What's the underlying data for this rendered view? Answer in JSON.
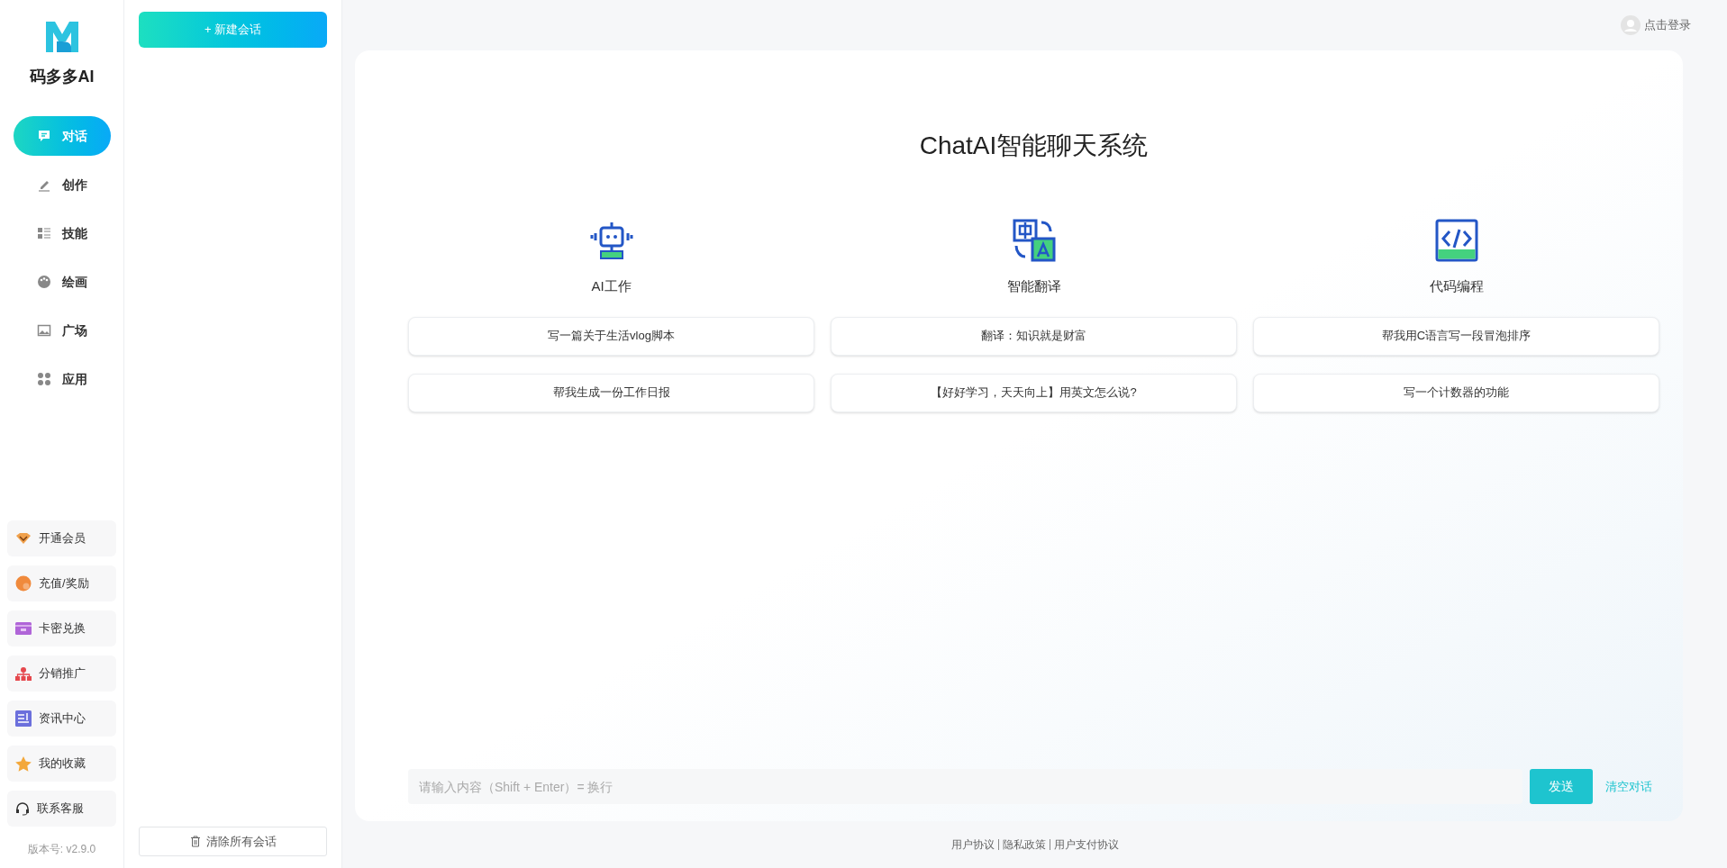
{
  "sidebar": {
    "brand": "码多多AI",
    "nav": [
      {
        "label": "对话",
        "kind": "chat",
        "selected": true
      },
      {
        "label": "创作",
        "kind": "pen",
        "selected": false
      },
      {
        "label": "技能",
        "kind": "list",
        "selected": false
      },
      {
        "label": "绘画",
        "kind": "palette",
        "selected": false
      },
      {
        "label": "广场",
        "kind": "image",
        "selected": false
      },
      {
        "label": "应用",
        "kind": "apps",
        "selected": false
      }
    ],
    "extras": [
      {
        "label": "开通会员",
        "kind": "vip"
      },
      {
        "label": "充值/奖励",
        "kind": "coin"
      },
      {
        "label": "卡密兑换",
        "kind": "card"
      },
      {
        "label": "分销推广",
        "kind": "tree"
      },
      {
        "label": "资讯中心",
        "kind": "news"
      },
      {
        "label": "我的收藏",
        "kind": "star"
      },
      {
        "label": "联系客服",
        "kind": "headset"
      }
    ],
    "version": "版本号: v2.9.0"
  },
  "sessions": {
    "new_button": "+ 新建会话",
    "clear_button": "清除所有会话"
  },
  "header": {
    "login": "点击登录"
  },
  "main": {
    "title": "ChatAI智能聊天系统",
    "categories": [
      {
        "title": "AI工作",
        "kind": "robot",
        "prompts": [
          "写一篇关于生活vlog脚本",
          "帮我生成一份工作日报"
        ]
      },
      {
        "title": "智能翻译",
        "kind": "translate",
        "prompts": [
          "翻译：知识就是财富",
          "【好好学习，天天向上】用英文怎么说?"
        ]
      },
      {
        "title": "代码编程",
        "kind": "code",
        "prompts": [
          "帮我用C语言写一段冒泡排序",
          "写一个计数器的功能"
        ]
      }
    ],
    "input": {
      "placeholder": "请输入内容（Shift + Enter）= 换行"
    },
    "send_button": "发送",
    "clear_link": "清空对话"
  },
  "footer": [
    "用户协议",
    "隐私政策",
    "用户支付协议"
  ]
}
